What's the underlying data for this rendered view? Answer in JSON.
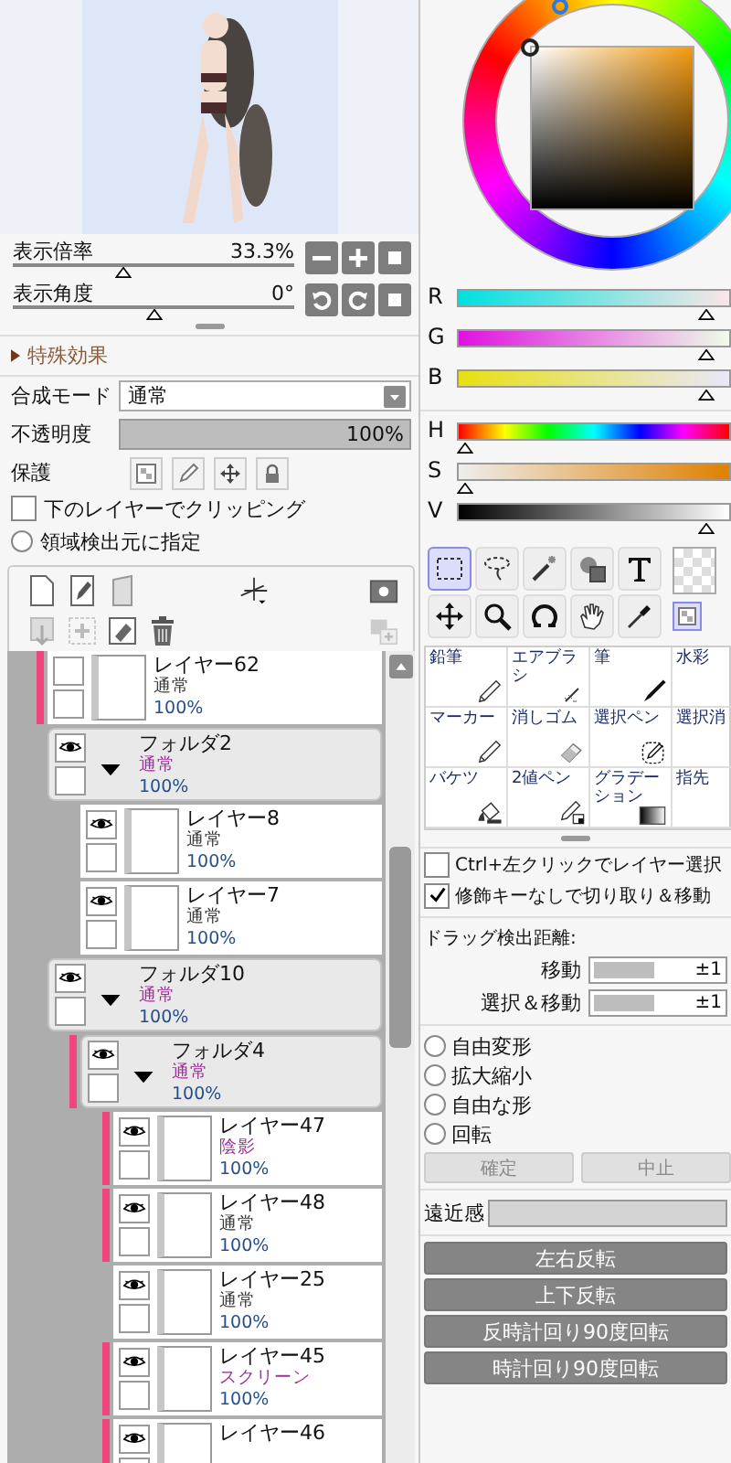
{
  "view": {
    "zoom": {
      "label": "表示倍率",
      "value": "33.3%",
      "level": 0.39
    },
    "angle": {
      "label": "表示角度",
      "value": "0°",
      "level": 0.5
    }
  },
  "effects": {
    "label": "特殊効果",
    "expanded": false
  },
  "blend": {
    "label": "合成モード",
    "value": "通常"
  },
  "opacity": {
    "label": "不透明度",
    "value": "100%",
    "level": 1
  },
  "protect": {
    "label": "保護"
  },
  "clipping": {
    "label": "下のレイヤーでクリッピング",
    "checked": false
  },
  "selection_source": {
    "label": "領域検出元に指定",
    "selected": false
  },
  "layers": [
    {
      "kind": "layer",
      "name": "レイヤー62",
      "mode": "通常",
      "opacity": "100%",
      "visible": false,
      "clipping": true,
      "color": "#3a3a3a"
    },
    {
      "kind": "folder",
      "name": "フォルダ2",
      "mode": "通常",
      "opacity": "100%",
      "visible": true,
      "clipping": false,
      "expanded": true,
      "color": "#a0309a",
      "children": [
        {
          "kind": "layer",
          "name": "レイヤー8",
          "mode": "通常",
          "opacity": "100%",
          "visible": true,
          "clipping": false,
          "color": "#3a3a3a"
        },
        {
          "kind": "layer",
          "name": "レイヤー7",
          "mode": "通常",
          "opacity": "100%",
          "visible": true,
          "clipping": false,
          "color": "#3a3a3a"
        }
      ]
    },
    {
      "kind": "folder",
      "name": "フォルダ10",
      "mode": "通常",
      "opacity": "100%",
      "visible": true,
      "clipping": false,
      "expanded": true,
      "color": "#a0309a",
      "children": [
        {
          "kind": "folder",
          "name": "フォルダ4",
          "mode": "通常",
          "opacity": "100%",
          "visible": true,
          "clipping": true,
          "expanded": true,
          "color": "#a0309a",
          "children": [
            {
              "kind": "layer",
              "name": "レイヤー47",
              "mode": "陰影",
              "opacity": "100%",
              "visible": true,
              "clipping": true,
              "color": "#a0309a"
            },
            {
              "kind": "layer",
              "name": "レイヤー48",
              "mode": "通常",
              "opacity": "100%",
              "visible": true,
              "clipping": true,
              "color": "#3a3a3a"
            },
            {
              "kind": "layer",
              "name": "レイヤー25",
              "mode": "通常",
              "opacity": "100%",
              "visible": true,
              "clipping": false,
              "color": "#3a3a3a"
            },
            {
              "kind": "layer",
              "name": "レイヤー45",
              "mode": "スクリーン",
              "opacity": "100%",
              "visible": true,
              "clipping": true,
              "color": "#a0309a"
            },
            {
              "kind": "layer",
              "name": "レイヤー46",
              "visible": true,
              "clipping": true
            }
          ]
        }
      ]
    }
  ],
  "color_sliders": [
    {
      "label": "R",
      "level": 0.88
    },
    {
      "label": "G",
      "level": 0.88
    },
    {
      "label": "B",
      "level": 0.88
    },
    {
      "label": "H",
      "level": 0.0
    },
    {
      "label": "S",
      "level": 0.0
    },
    {
      "label": "V",
      "level": 0.88
    }
  ],
  "tools": [
    {
      "kind": "rect-select",
      "selected": true
    },
    {
      "kind": "lasso",
      "selected": false
    },
    {
      "kind": "wand",
      "selected": false
    },
    {
      "kind": "shapes",
      "selected": false
    },
    {
      "kind": "text",
      "selected": false
    },
    {
      "kind": "move",
      "selected": false
    },
    {
      "kind": "zoom",
      "selected": false
    },
    {
      "kind": "rotate",
      "selected": false
    },
    {
      "kind": "hand",
      "selected": false
    },
    {
      "kind": "eyedropper",
      "selected": false
    }
  ],
  "brushes": [
    {
      "name": "鉛筆",
      "kind": "pencil"
    },
    {
      "name": "エアブラシ",
      "kind": "airbrush"
    },
    {
      "name": "筆",
      "kind": "brush"
    },
    {
      "name": "水彩"
    },
    {
      "name": "マーカー",
      "kind": "pencil"
    },
    {
      "name": "消しゴム",
      "kind": "eraser"
    },
    {
      "name": "選択ペン",
      "kind": "select-pen"
    },
    {
      "name": "選択消"
    },
    {
      "name": "バケツ",
      "kind": "bucket"
    },
    {
      "name": "2値ペン",
      "kind": "binary-pen"
    },
    {
      "name": "グラデーション",
      "kind": "gradient"
    },
    {
      "name": "指先"
    }
  ],
  "options": [
    {
      "label": "Ctrl+左クリックでレイヤー選択",
      "checked": false
    },
    {
      "label": "修飾キーなしで切り取り＆移動",
      "checked": true
    }
  ],
  "drag": {
    "label": "ドラッグ検出距離:",
    "fields": [
      {
        "label": "移動",
        "value": "±1",
        "level": 0.45
      },
      {
        "label": "選択＆移動",
        "value": "±1",
        "level": 0.45
      }
    ]
  },
  "transform": [
    {
      "label": "自由変形",
      "selected": false
    },
    {
      "label": "拡大縮小",
      "selected": false
    },
    {
      "label": "自由な形",
      "selected": false
    },
    {
      "label": "回転",
      "selected": false
    }
  ],
  "transform_buttons": [
    {
      "label": "確定",
      "disabled": true
    },
    {
      "label": "中止",
      "disabled": true
    }
  ],
  "perspective": {
    "label": "遠近感",
    "level": 0
  },
  "actions": [
    "左右反転",
    "上下反転",
    "反時計回り90度回転",
    "時計回り90度回転"
  ]
}
